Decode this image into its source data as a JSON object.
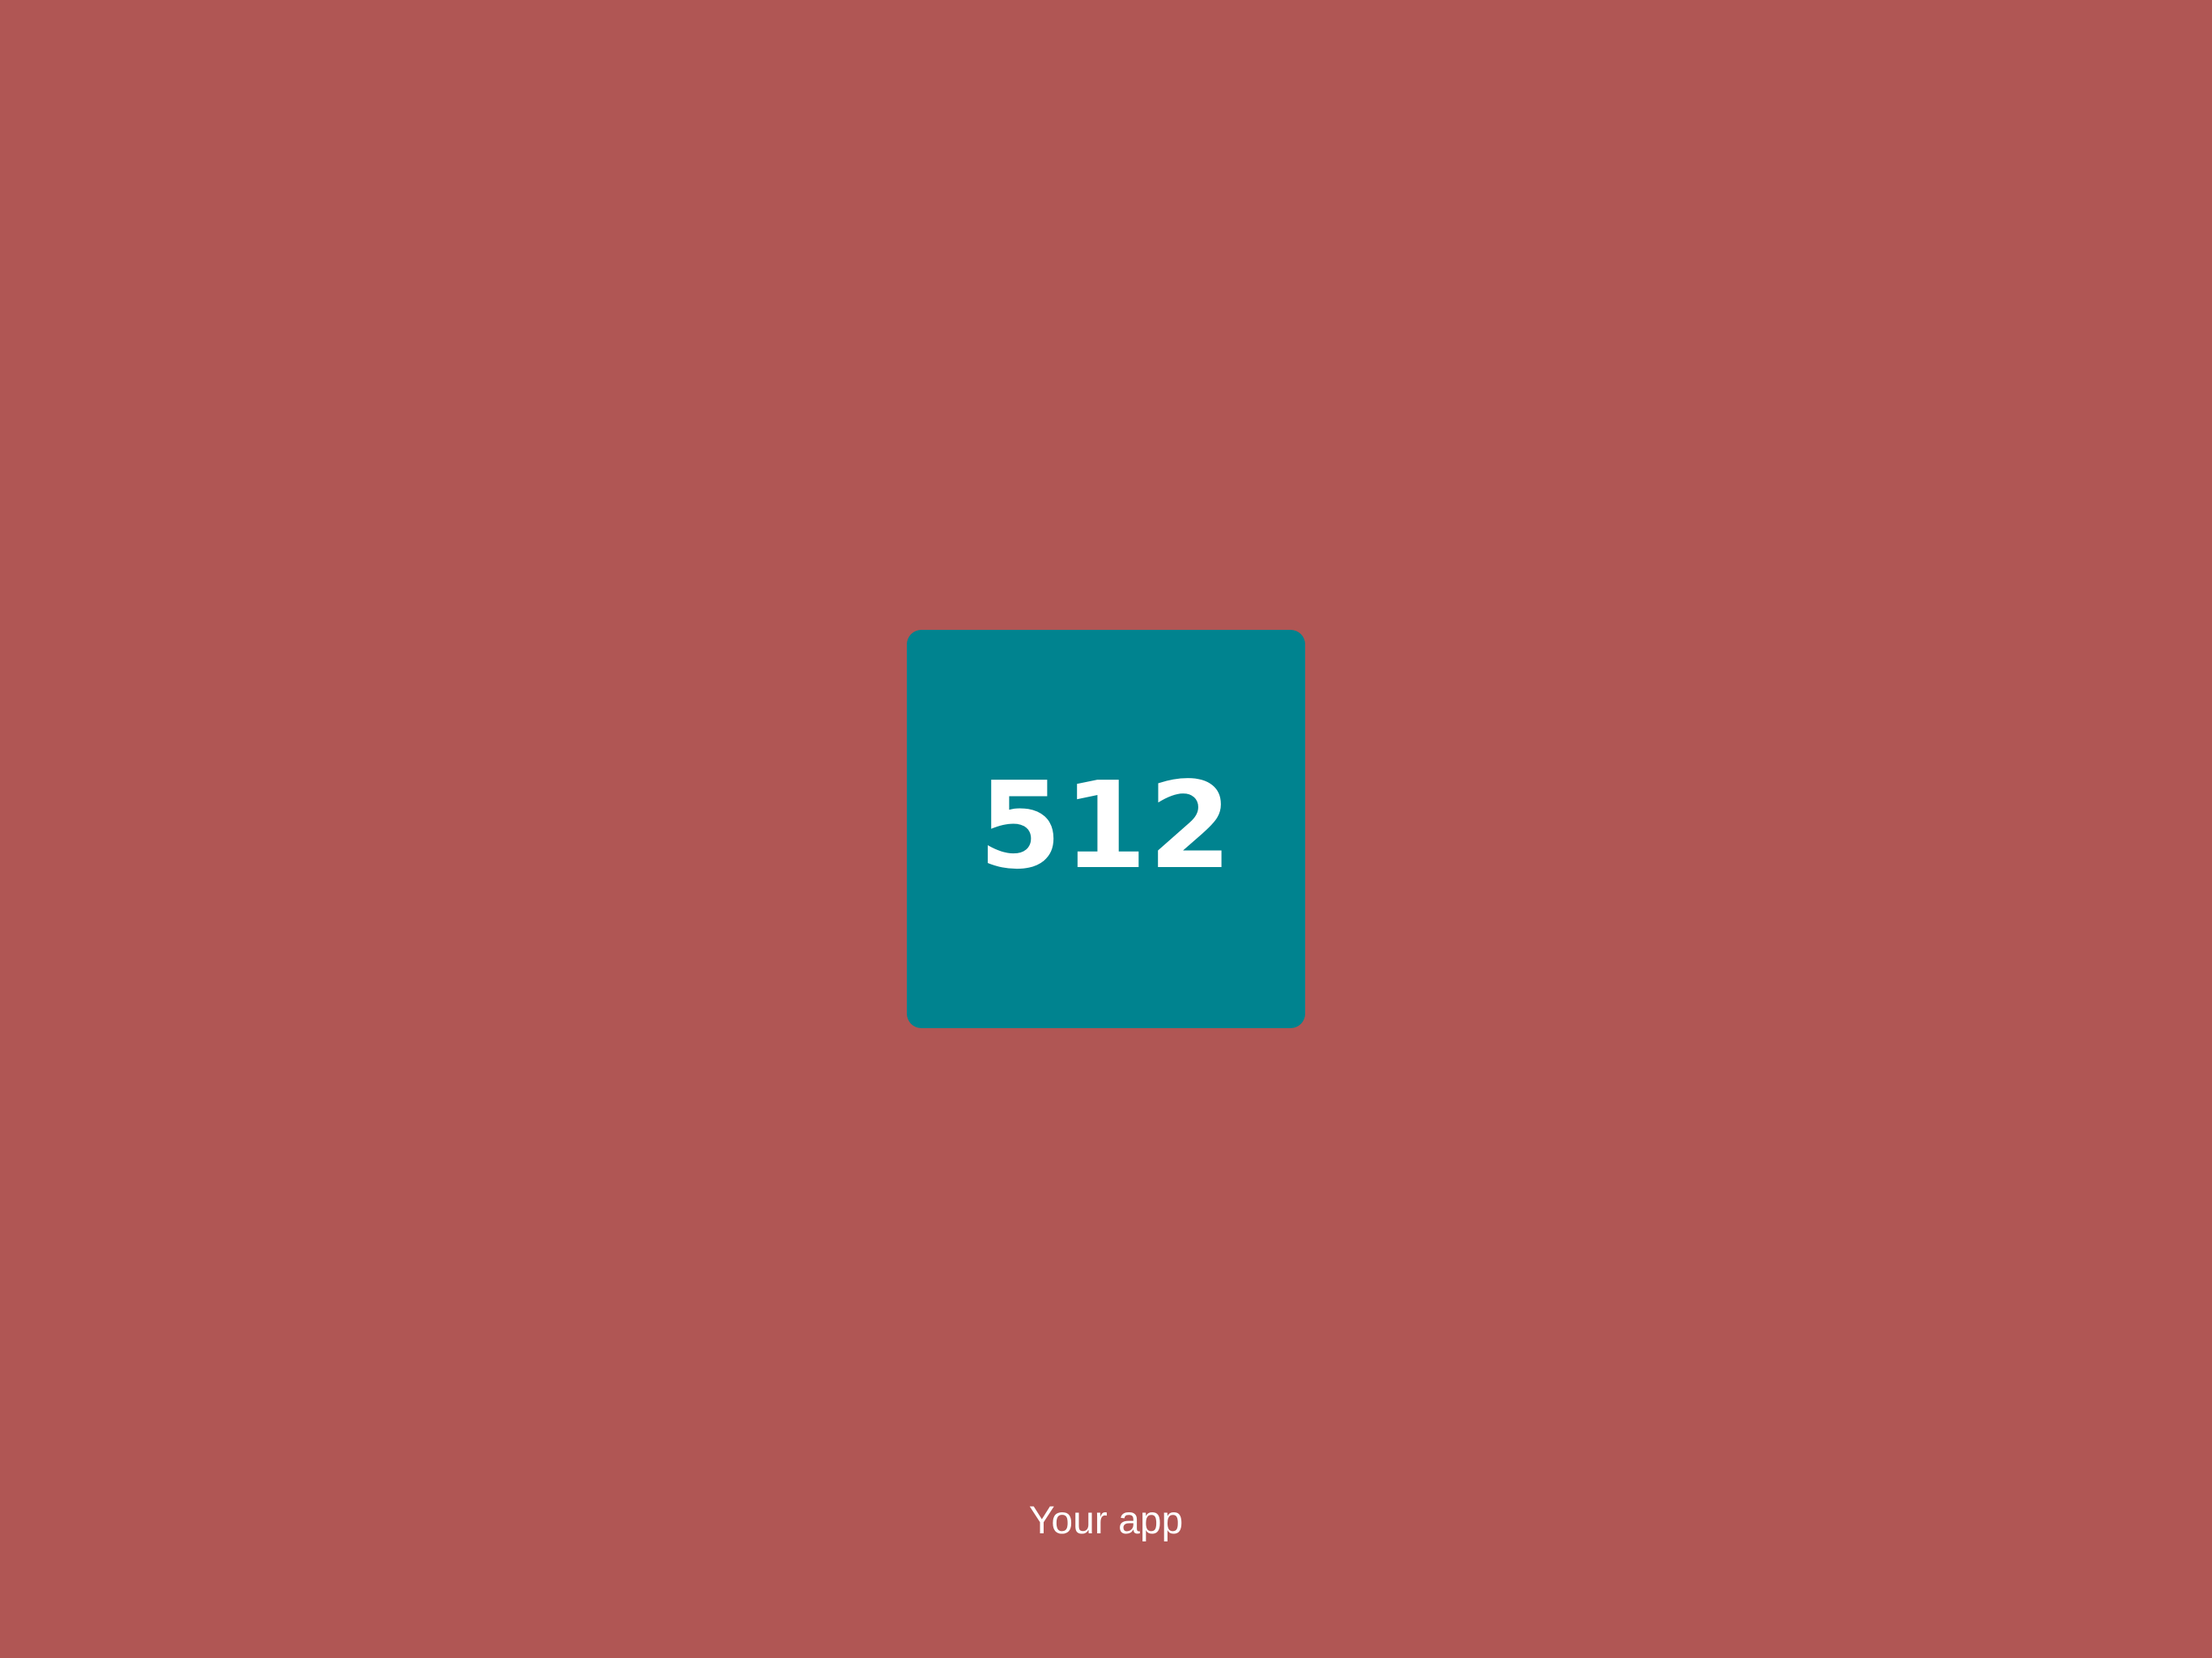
{
  "splash": {
    "background_color": "#b05654",
    "icon": {
      "label": "512",
      "color": "#00838f"
    },
    "app_name": "Your app"
  }
}
